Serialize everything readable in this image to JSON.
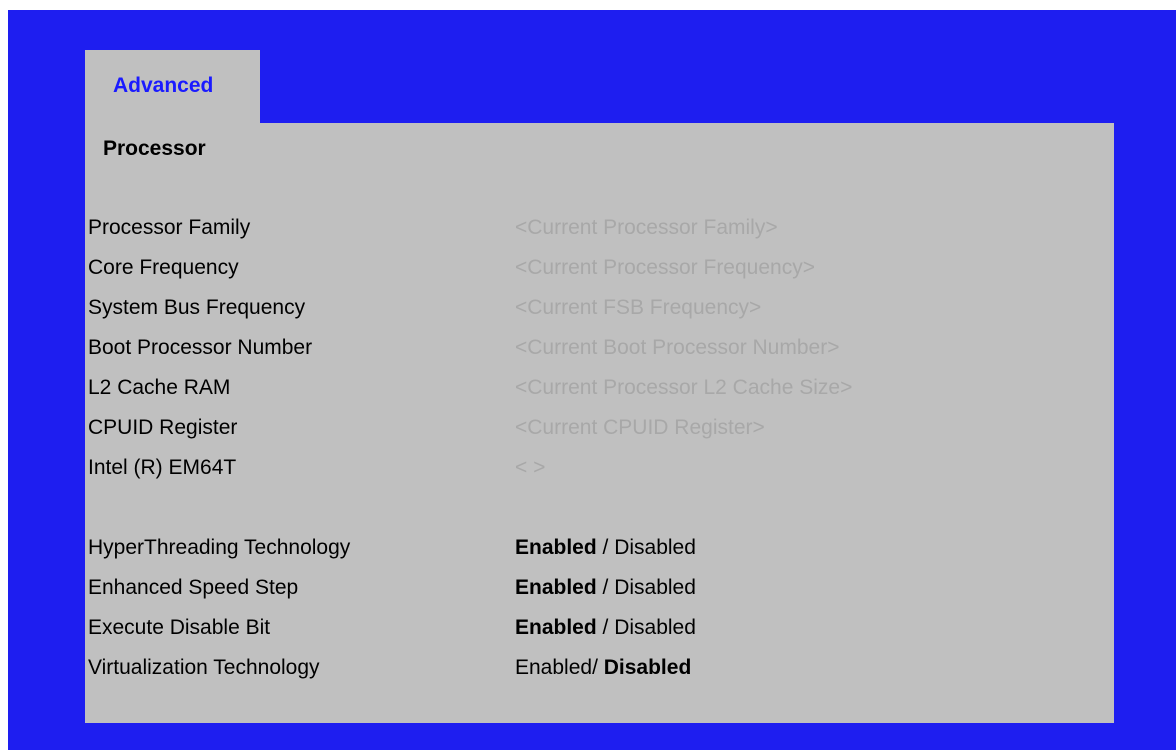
{
  "tab": {
    "label": "Advanced"
  },
  "section": {
    "title": "Processor"
  },
  "info_rows": [
    {
      "label": "Processor Family",
      "value": "<Current Processor Family>"
    },
    {
      "label": "Core Frequency",
      "value": "<Current Processor Frequency>"
    },
    {
      "label": "System Bus Frequency",
      "value": "<Current FSB Frequency>"
    },
    {
      "label": "Boot Processor Number",
      "value": "<Current Boot Processor Number>"
    },
    {
      "label": "L2 Cache RAM",
      "value": "<Current Processor L2 Cache Size>"
    },
    {
      "label": "CPUID Register",
      "value": "<Current CPUID Register>"
    },
    {
      "label": "Intel (R) EM64T",
      "value": "< >"
    }
  ],
  "setting_rows": [
    {
      "label": "HyperThreading Technology",
      "enabled": "Enabled",
      "sep": " / ",
      "disabled": "Disabled",
      "selected": "Enabled"
    },
    {
      "label": "Enhanced Speed Step",
      "enabled": "Enabled",
      "sep": " / ",
      "disabled": "Disabled",
      "selected": "Enabled"
    },
    {
      "label": "Execute Disable Bit",
      "enabled": "Enabled",
      "sep": " / ",
      "disabled": "Disabled",
      "selected": "Enabled"
    },
    {
      "label": "Virtualization Technology",
      "enabled": "Enabled",
      "sep": "/ ",
      "disabled": "Disabled",
      "selected": "Disabled"
    }
  ],
  "colors": {
    "frame": "#1e1ef0",
    "panel": "#c0c0c0",
    "tab_text": "#1a1aff",
    "info_value": "#a8a8a8"
  }
}
